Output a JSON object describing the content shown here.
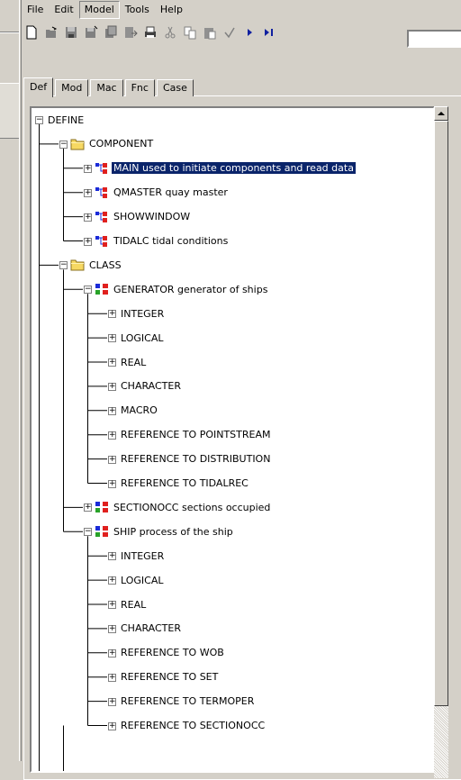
{
  "menu": [
    "File",
    "Edit",
    "Model",
    "Tools",
    "Help"
  ],
  "active_menu": "Model",
  "toolbar_icons": [
    "new-file-icon",
    "open-icon",
    "save-icon",
    "save-as-icon",
    "copy-doc-icon",
    "export-icon",
    "print-icon",
    "cut-icon",
    "copy-icon",
    "paste-icon",
    "check-icon",
    "run-icon",
    "step-icon"
  ],
  "tabs": [
    "Def",
    "Mod",
    "Mac",
    "Fnc",
    "Case"
  ],
  "active_tab": "Def",
  "tree": [
    {
      "label": "DEFINE",
      "level": 0,
      "exp": "-",
      "icon": null
    },
    {
      "label": "COMPONENT",
      "level": 1,
      "exp": "-",
      "icon": "folder"
    },
    {
      "label": "MAIN used to initiate components and read data",
      "level": 2,
      "exp": "+",
      "icon": "component",
      "selected": true
    },
    {
      "label": "QMASTER quay master",
      "level": 2,
      "exp": "+",
      "icon": "component"
    },
    {
      "label": "SHOWWINDOW",
      "level": 2,
      "exp": "+",
      "icon": "component"
    },
    {
      "label": "TIDALC tidal conditions",
      "level": 2,
      "exp": "+",
      "icon": "component",
      "last": true
    },
    {
      "label": "CLASS",
      "level": 1,
      "exp": "-",
      "icon": "folder"
    },
    {
      "label": "GENERATOR  generator of ships",
      "level": 2,
      "exp": "-",
      "icon": "class"
    },
    {
      "label": "INTEGER",
      "level": 3,
      "exp": "+",
      "icon": null
    },
    {
      "label": "LOGICAL",
      "level": 3,
      "exp": "+",
      "icon": null
    },
    {
      "label": "REAL",
      "level": 3,
      "exp": "+",
      "icon": null
    },
    {
      "label": "CHARACTER",
      "level": 3,
      "exp": "+",
      "icon": null
    },
    {
      "label": "MACRO",
      "level": 3,
      "exp": "+",
      "icon": null
    },
    {
      "label": "REFERENCE TO POINTSTREAM",
      "level": 3,
      "exp": "+",
      "icon": null
    },
    {
      "label": "REFERENCE TO DISTRIBUTION",
      "level": 3,
      "exp": "+",
      "icon": null
    },
    {
      "label": "REFERENCE TO TIDALREC",
      "level": 3,
      "exp": "+",
      "icon": null,
      "last": true
    },
    {
      "label": "SECTIONOCC sections occupied",
      "level": 2,
      "exp": "+",
      "icon": "class"
    },
    {
      "label": "SHIP process of the ship",
      "level": 2,
      "exp": "-",
      "icon": "class"
    },
    {
      "label": "INTEGER",
      "level": 3,
      "exp": "+",
      "icon": null
    },
    {
      "label": "LOGICAL",
      "level": 3,
      "exp": "+",
      "icon": null
    },
    {
      "label": "REAL",
      "level": 3,
      "exp": "+",
      "icon": null
    },
    {
      "label": "CHARACTER",
      "level": 3,
      "exp": "+",
      "icon": null
    },
    {
      "label": "REFERENCE TO WOB",
      "level": 3,
      "exp": "+",
      "icon": null
    },
    {
      "label": "REFERENCE TO SET",
      "level": 3,
      "exp": "+",
      "icon": null
    },
    {
      "label": "REFERENCE TO TERMOPER",
      "level": 3,
      "exp": "+",
      "icon": null
    },
    {
      "label": "REFERENCE TO SECTIONOCC",
      "level": 3,
      "exp": "+",
      "icon": null,
      "last": true
    }
  ],
  "colors": {
    "selection": "#0a246a",
    "folder": "#f6d862",
    "component_red": "#e0201e",
    "component_blue": "#1b2bd8",
    "class_green": "#28a228"
  }
}
